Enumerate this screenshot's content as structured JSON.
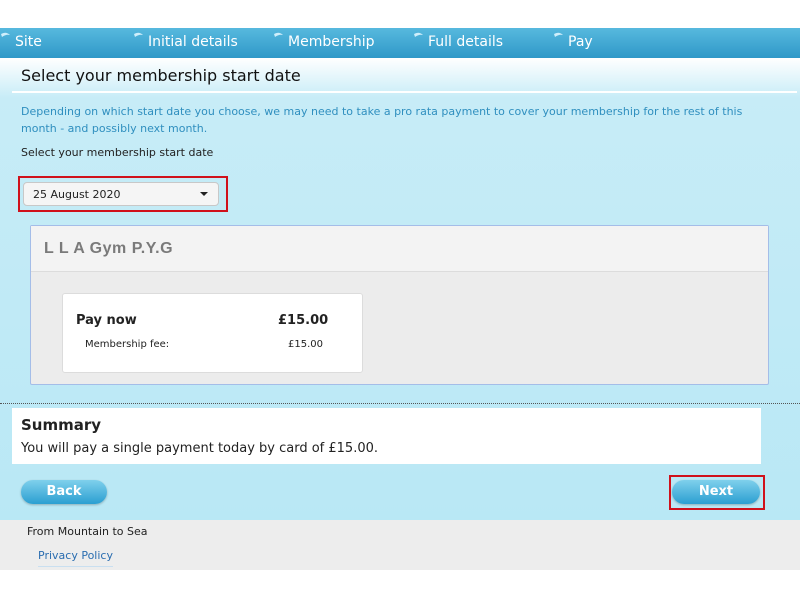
{
  "nav": {
    "steps": [
      {
        "label": "Site"
      },
      {
        "label": "Initial details"
      },
      {
        "label": "Membership"
      },
      {
        "label": "Full details"
      },
      {
        "label": "Pay"
      }
    ]
  },
  "main": {
    "title": "Select your membership start date",
    "info": "Depending on which start date you choose, we may need to take a pro rata payment to cover your membership for the rest of this month - and possibly next month.",
    "select_label": "Select your membership start date",
    "start_date_selected": "25 August 2020"
  },
  "card": {
    "title": "L L A Gym P.Y.G",
    "pay_now_label": "Pay now",
    "pay_now_amount": "£15.00",
    "fee_label": "Membership fee:",
    "fee_amount": "£15.00"
  },
  "summary": {
    "title": "Summary",
    "text": "You will pay a single payment today by card of £15.00."
  },
  "buttons": {
    "back": "Back",
    "next": "Next"
  },
  "footer": {
    "tagline": "From Mountain to Sea",
    "privacy": "Privacy Policy"
  },
  "colors": {
    "accent": "#2f98c8",
    "highlight": "#d0111b"
  }
}
